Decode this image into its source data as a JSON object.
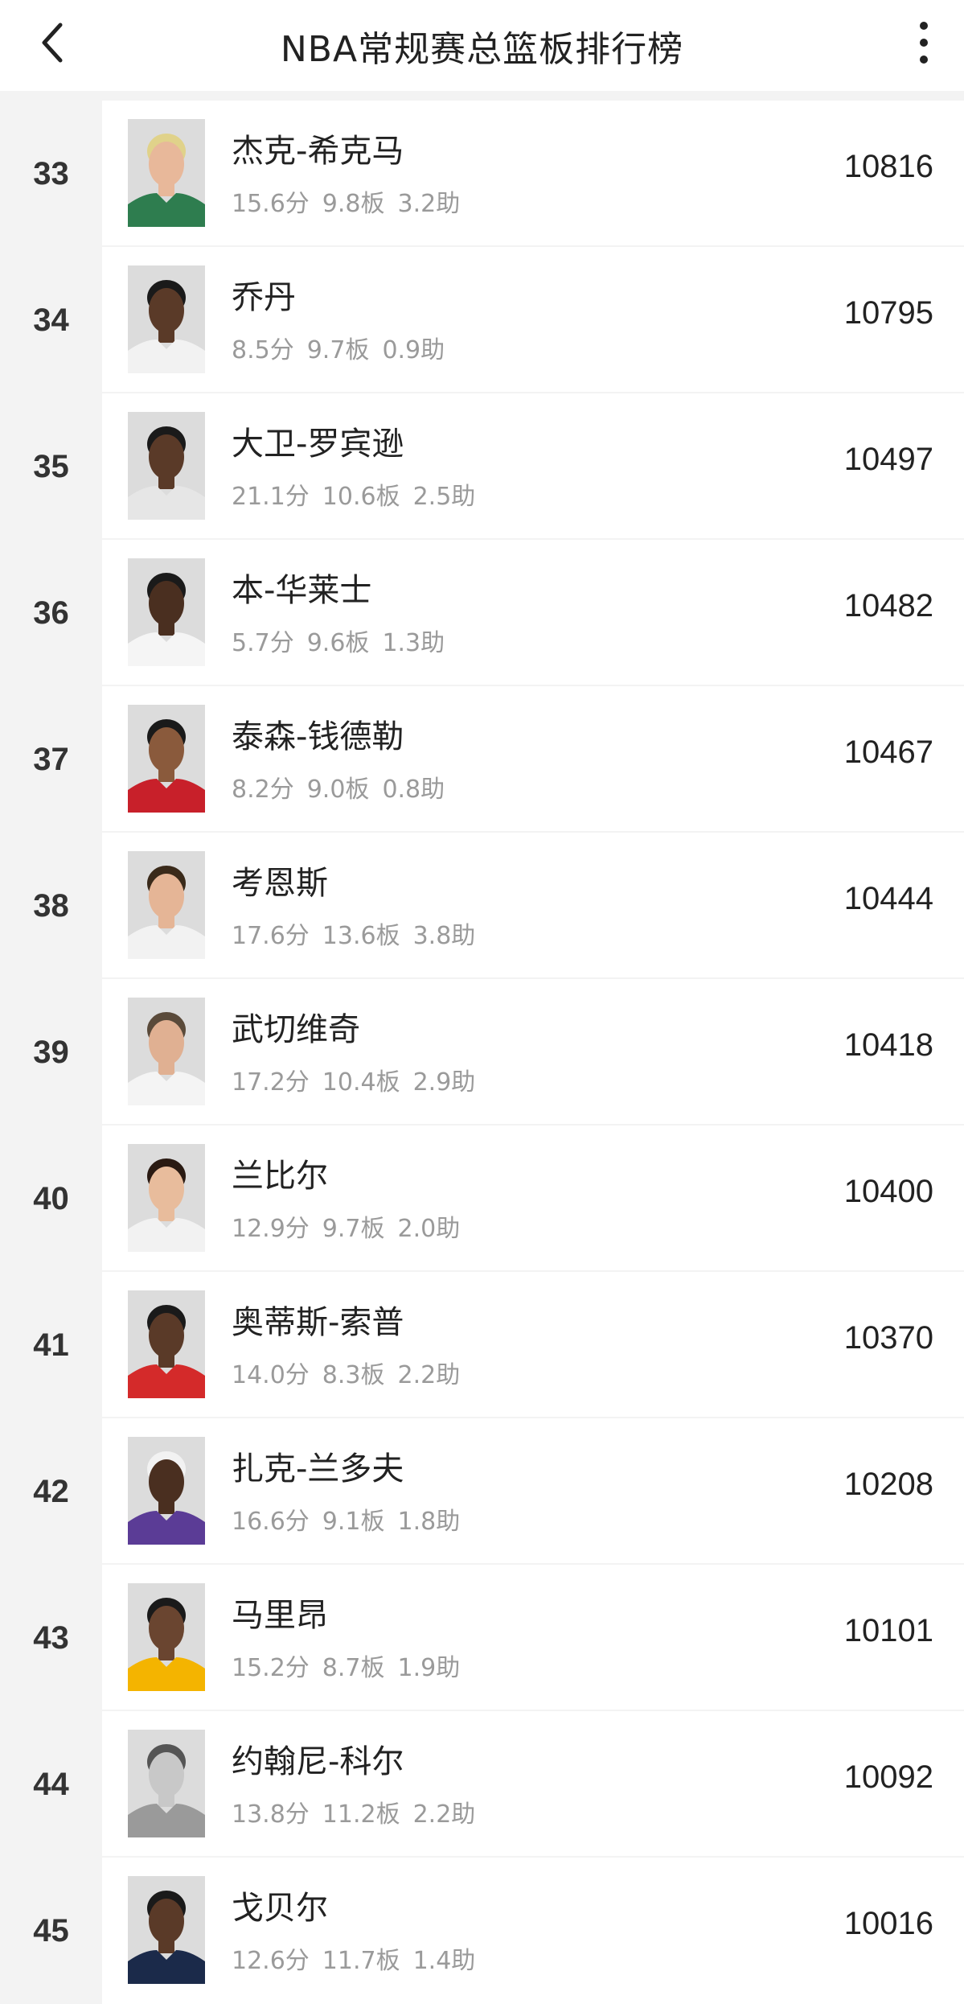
{
  "header": {
    "title": "NBA常规赛总篮板排行榜",
    "back_icon": "chevron-left-icon",
    "more_icon": "more-vertical-icon"
  },
  "players": [
    {
      "rank": "33",
      "name": "杰克-希克马",
      "pts": "15.6分",
      "reb": "9.8板",
      "ast": "3.2助",
      "total": "10816",
      "jersey": "#2e7d4f",
      "skin": "#e8b89a",
      "hair": "#e0d28a"
    },
    {
      "rank": "34",
      "name": "乔丹",
      "pts": "8.5分",
      "reb": "9.7板",
      "ast": "0.9助",
      "total": "10795",
      "jersey": "#f2f2f2",
      "skin": "#5a3a28",
      "hair": "#1a1a1a"
    },
    {
      "rank": "35",
      "name": "大卫-罗宾逊",
      "pts": "21.1分",
      "reb": "10.6板",
      "ast": "2.5助",
      "total": "10497",
      "jersey": "#e6e6e6",
      "skin": "#5a3a28",
      "hair": "#1a1a1a"
    },
    {
      "rank": "36",
      "name": "本-华莱士",
      "pts": "5.7分",
      "reb": "9.6板",
      "ast": "1.3助",
      "total": "10482",
      "jersey": "#f5f5f5",
      "skin": "#4a2f20",
      "hair": "#1a1a1a"
    },
    {
      "rank": "37",
      "name": "泰森-钱德勒",
      "pts": "8.2分",
      "reb": "9.0板",
      "ast": "0.8助",
      "total": "10467",
      "jersey": "#c8202a",
      "skin": "#8a5a3c",
      "hair": "#1a1a1a"
    },
    {
      "rank": "38",
      "name": "考恩斯",
      "pts": "17.6分",
      "reb": "13.6板",
      "ast": "3.8助",
      "total": "10444",
      "jersey": "#f2f2f2",
      "skin": "#e5b596",
      "hair": "#3a2a1a"
    },
    {
      "rank": "39",
      "name": "武切维奇",
      "pts": "17.2分",
      "reb": "10.4板",
      "ast": "2.9助",
      "total": "10418",
      "jersey": "#f4f4f4",
      "skin": "#e0b092",
      "hair": "#5a4a3a"
    },
    {
      "rank": "40",
      "name": "兰比尔",
      "pts": "12.9分",
      "reb": "9.7板",
      "ast": "2.0助",
      "total": "10400",
      "jersey": "#f2f2f2",
      "skin": "#e8bc9c",
      "hair": "#2a1a12"
    },
    {
      "rank": "41",
      "name": "奥蒂斯-索普",
      "pts": "14.0分",
      "reb": "8.3板",
      "ast": "2.2助",
      "total": "10370",
      "jersey": "#d42a2a",
      "skin": "#5a3a28",
      "hair": "#1a1a1a"
    },
    {
      "rank": "42",
      "name": "扎克-兰多夫",
      "pts": "16.6分",
      "reb": "9.1板",
      "ast": "1.8助",
      "total": "10208",
      "jersey": "#5b3c96",
      "skin": "#4a2f20",
      "hair": "#f2f2f2"
    },
    {
      "rank": "43",
      "name": "马里昂",
      "pts": "15.2分",
      "reb": "8.7板",
      "ast": "1.9助",
      "total": "10101",
      "jersey": "#f4b400",
      "skin": "#6a4530",
      "hair": "#1a1a1a"
    },
    {
      "rank": "44",
      "name": "约翰尼-科尔",
      "pts": "13.8分",
      "reb": "11.2板",
      "ast": "2.2助",
      "total": "10092",
      "jersey": "#9a9a9a",
      "skin": "#c8c8c8",
      "hair": "#555555"
    },
    {
      "rank": "45",
      "name": "戈贝尔",
      "pts": "12.6分",
      "reb": "11.7板",
      "ast": "1.4助",
      "total": "10016",
      "jersey": "#1b2a4a",
      "skin": "#5a3a28",
      "hair": "#1a1a1a"
    }
  ]
}
